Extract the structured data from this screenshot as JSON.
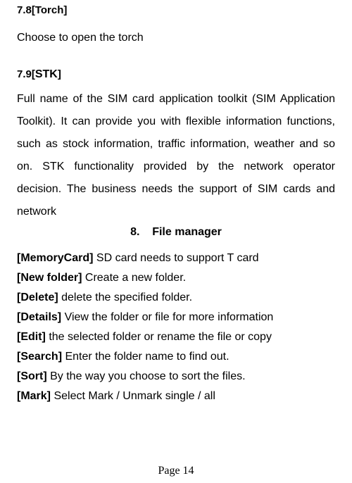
{
  "sections": {
    "s78": {
      "heading": "7.8[Torch]",
      "body": "Choose to open the torch"
    },
    "s79": {
      "heading_prefix": "7.9[",
      "heading_bold": "STK",
      "heading_suffix": "]",
      "body": " Full name of the SIM card application toolkit (SIM Application Toolkit). It can provide you with flexible information functions, such as stock information, traffic information, weather and so on. STK functionality provided by the network operator decision. The business needs the support of SIM cards and network"
    }
  },
  "chapter": {
    "number": "8.",
    "title": "File manager"
  },
  "file_manager_items": [
    {
      "label": "[MemoryCard]",
      "desc": " SD card needs to support T card"
    },
    {
      "label": "[New folder]",
      "desc": "   Create a new folder."
    },
    {
      "label": "[Delete]",
      "desc": " delete the specified folder."
    },
    {
      "label": "[Details]",
      "desc": " View the folder or file for more information"
    },
    {
      "label": "[Edit]",
      "desc": " the selected folder or rename the file or copy"
    },
    {
      "label": "[Search]",
      "desc": " Enter the folder name to find out."
    },
    {
      "label": "[Sort]",
      "desc": " By the way you choose to sort the files."
    },
    {
      "label": "[Mark]",
      "desc": " Select Mark / Unmark single / all"
    }
  ],
  "page_number": "Page 14"
}
